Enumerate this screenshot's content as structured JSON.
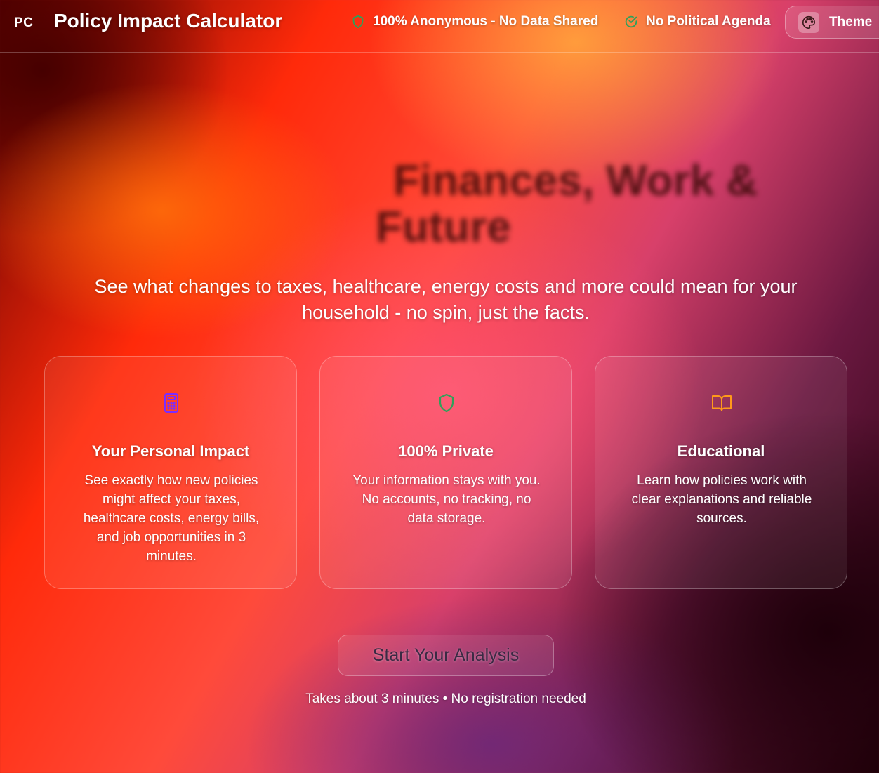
{
  "header": {
    "logo": "PC",
    "title": "Policy Impact Calculator",
    "badges": [
      {
        "label": "100% Anonymous - No Data Shared",
        "icon": "shield-icon",
        "color": "#2fa05a"
      },
      {
        "label": "No Political Agenda",
        "icon": "check-circle-icon",
        "color": "#2fa05a"
      }
    ],
    "theme_label": "Theme"
  },
  "hero": {
    "heading_line1": "Finances, Work &",
    "heading_line2": "Future",
    "subtitle": "See what changes to taxes, healthcare, energy costs and more could mean for your household - no spin, just the facts."
  },
  "cards": [
    {
      "icon": "calculator-icon",
      "icon_color": "#7b2cff",
      "title": "Your Personal Impact",
      "body": "See exactly how new policies might affect your taxes, healthcare costs, energy bills, and job opportunities in 3 minutes."
    },
    {
      "icon": "shield-icon",
      "icon_color": "#2fa05a",
      "title": "100% Private",
      "body": "Your information stays with you. No accounts, no tracking, no data storage."
    },
    {
      "icon": "book-open-icon",
      "icon_color": "#ff9a1a",
      "title": "Educational",
      "body": "Learn how policies work with clear explanations and reliable sources."
    }
  ],
  "cta": {
    "button_label": "Start Your Analysis",
    "note": "Takes about 3 minutes • No registration needed"
  }
}
